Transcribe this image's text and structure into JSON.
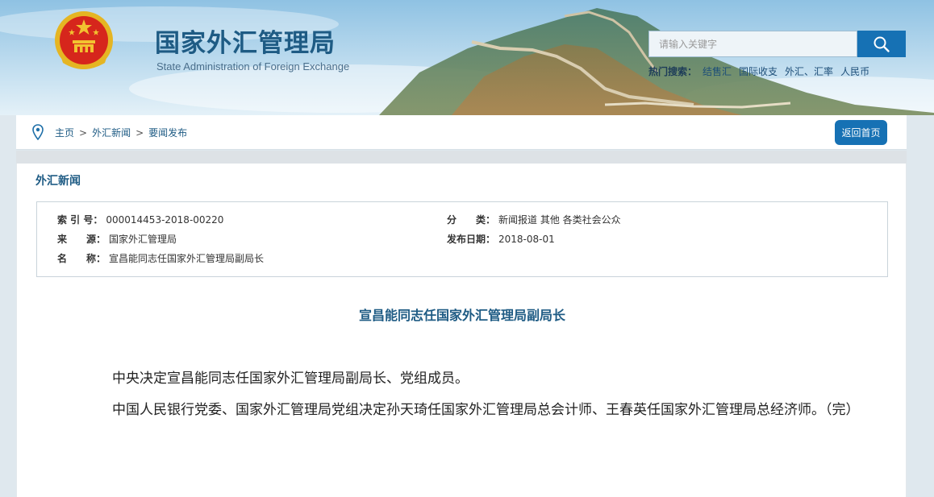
{
  "site": {
    "title": "国家外汇管理局",
    "subtitle": "State Administration of Foreign Exchange"
  },
  "search": {
    "placeholder": "请输入关键字",
    "hot_label": "热门搜索：",
    "hot_terms": [
      "结售汇",
      "国际收支",
      "外汇、汇率",
      "人民币"
    ]
  },
  "breadcrumb": {
    "items": [
      "主页",
      "外汇新闻",
      "要闻发布"
    ],
    "separator": ">"
  },
  "home_button": "返回首页",
  "section_title": "外汇新闻",
  "meta": {
    "index_label": "索 引 号：",
    "index_value": "000014453-2018-00220",
    "category_label": "分　　类：",
    "category_value": "新闻报道  其他  各类社会公众",
    "source_label": "来　　源：",
    "source_value": "国家外汇管理局",
    "date_label": "发布日期：",
    "date_value": "2018-08-01",
    "name_label": "名　　称：",
    "name_value": "宣昌能同志任国家外汇管理局副局长"
  },
  "article": {
    "title": "宣昌能同志任国家外汇管理局副局长",
    "paragraphs": [
      "中央决定宣昌能同志任国家外汇管理局副局长、党组成员。",
      "中国人民银行党委、国家外汇管理局党组决定孙天琦任国家外汇管理局总会计师、王春英任国家外汇管理局总经济师。（完）"
    ]
  },
  "colors": {
    "brand_blue": "#1e5b84",
    "button_blue": "#1671b4",
    "emblem_red": "#d6261c",
    "emblem_gold": "#f2c230"
  },
  "icons": [
    "national-emblem-icon",
    "search-icon",
    "location-pin-icon"
  ]
}
